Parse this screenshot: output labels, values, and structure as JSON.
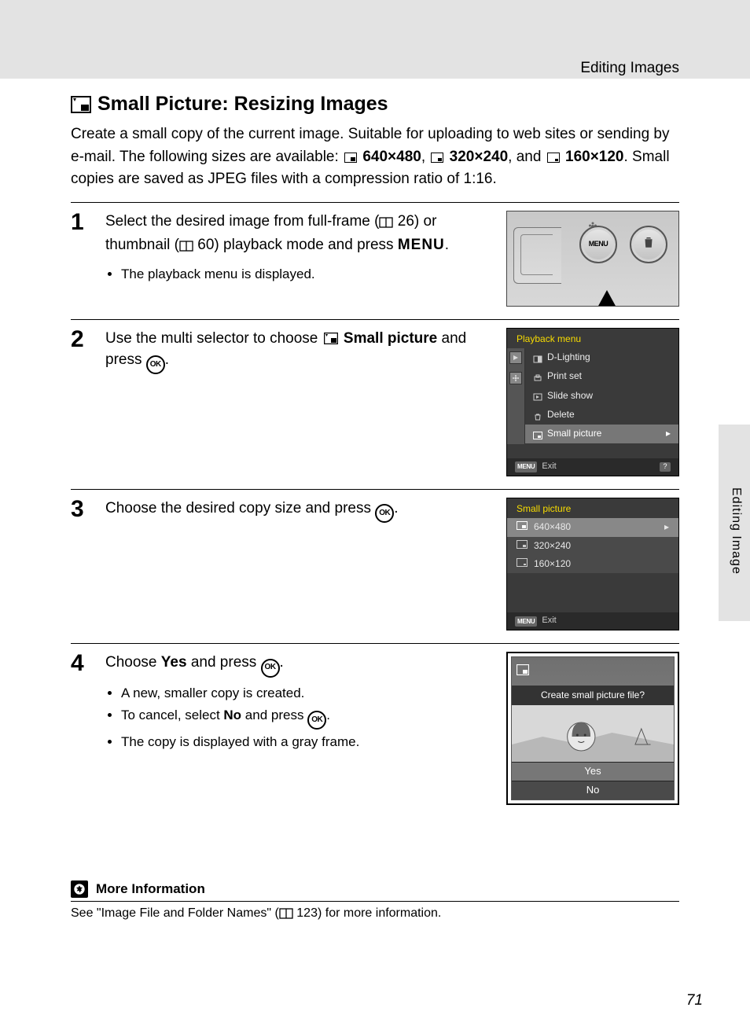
{
  "header": {
    "section": "Editing Images",
    "side_tab": "Editing Image"
  },
  "title": "Small Picture: Resizing Images",
  "intro": {
    "pre": "Create a small copy of the current image. Suitable for uploading to web sites or sending by e-mail. The following sizes are available: ",
    "size1": "640×480",
    "sep1": ", ",
    "size2": "320×240",
    "sep2": ", and ",
    "size3": "160×120",
    "post": ". Small copies are saved as JPEG files with a compression ratio of 1:16."
  },
  "steps": [
    {
      "num": "1",
      "instr_parts": {
        "a": "Select the desired image from full-frame (",
        "ref1": "26",
        "b": ") or thumbnail (",
        "ref2": "60",
        "c": ") playback mode and press ",
        "menu": "MENU",
        "d": "."
      },
      "bullets": [
        "The playback menu is displayed."
      ],
      "camera_buttons": {
        "menu": "MENU"
      }
    },
    {
      "num": "2",
      "instr_parts": {
        "a": "Use the multi selector to choose ",
        "b": "Small picture",
        "c": " and press ",
        "d": "."
      },
      "lcd": {
        "title": "Playback menu",
        "items": [
          "D-Lighting",
          "Print set",
          "Slide show",
          "Delete",
          "Small picture"
        ],
        "selected": 4,
        "foot_menu": "MENU",
        "foot_exit": "Exit",
        "foot_help": "?"
      }
    },
    {
      "num": "3",
      "instr_parts": {
        "a": "Choose the desired copy size and press ",
        "b": "."
      },
      "lcd": {
        "title": "Small picture",
        "sizes": [
          "640×480",
          "320×240",
          "160×120"
        ],
        "selected": 0,
        "foot_menu": "MENU",
        "foot_exit": "Exit"
      }
    },
    {
      "num": "4",
      "instr_parts": {
        "a": "Choose ",
        "yes": "Yes",
        "b": " and press ",
        "c": "."
      },
      "bullets": [
        "A new, smaller copy is created.",
        "To cancel, select __NO__ and press __OK__.",
        "The copy is displayed with a gray frame."
      ],
      "confirm": {
        "question": "Create small picture file?",
        "yes": "Yes",
        "no": "No"
      }
    }
  ],
  "more_info": {
    "head": "More Information",
    "body_pre": "See \"Image File and Folder Names\" (",
    "ref": "123",
    "body_post": ") for more information."
  },
  "page_number": "71"
}
